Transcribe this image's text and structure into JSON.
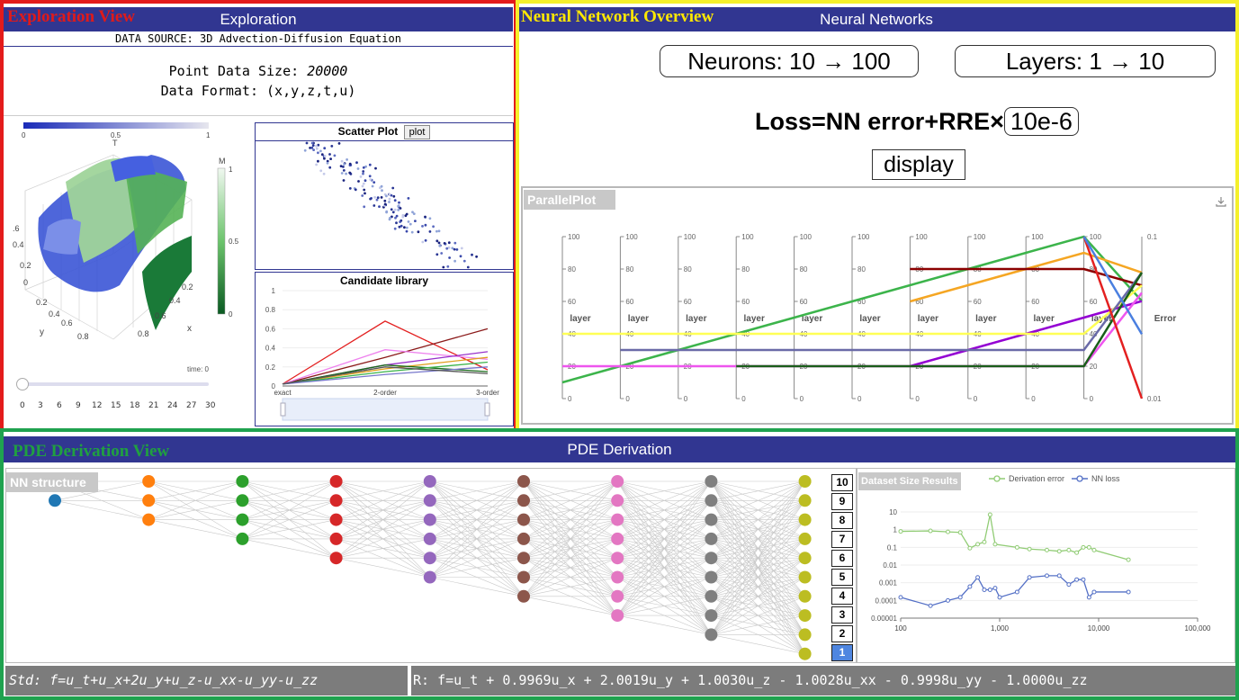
{
  "exploration": {
    "tag": "Exploration View",
    "title": "Exploration",
    "data_source": "DATA SOURCE: 3D Advection-Diffusion Equation",
    "point_size_label": "Point Data Size: ",
    "point_size_value": "20000",
    "data_format": "Data Format: (x,y,z,t,u)",
    "colorbar_t": {
      "label": "T",
      "ticks": [
        "0",
        "0.5",
        "1"
      ]
    },
    "colorbar_m": {
      "label": "M",
      "ticks": [
        "1",
        "0.5",
        "0"
      ]
    },
    "axis_labels": {
      "y": "y",
      "x": "x",
      "z_ticks": [
        ".6",
        "0.4",
        "0.2",
        "0",
        "0.2",
        "0.4",
        "0.6",
        "0.8"
      ],
      "x_ticks": [
        "0.2",
        "0.4",
        "0.6",
        "0.8",
        "x"
      ]
    },
    "time_label": "time: 0",
    "slider": {
      "value": 0,
      "ticks": [
        "0",
        "3",
        "6",
        "9",
        "12",
        "15",
        "18",
        "21",
        "24",
        "27",
        "30"
      ]
    },
    "scatter": {
      "title": "Scatter Plot",
      "button": "plot"
    },
    "candidate": {
      "title": "Candidate library",
      "chart_data": {
        "type": "line",
        "categories": [
          "exact",
          "2-order",
          "3-order"
        ],
        "ylim": [
          0,
          1
        ],
        "yticks": [
          "0",
          "0.2",
          "0.4",
          "0.6",
          "0.8",
          "1"
        ],
        "series": [
          {
            "values": [
              0.02,
              0.68,
              0.17
            ],
            "color": "#e32020"
          },
          {
            "values": [
              0.02,
              0.3,
              0.6
            ],
            "color": "#8b1a1a"
          },
          {
            "values": [
              0.02,
              0.38,
              0.28
            ],
            "color": "#ee82ee"
          },
          {
            "values": [
              0.02,
              0.22,
              0.36
            ],
            "color": "#9932cc"
          },
          {
            "values": [
              0.02,
              0.18,
              0.3
            ],
            "color": "#e0a020"
          },
          {
            "values": [
              0.02,
              0.22,
              0.15
            ],
            "color": "#1a6b1a"
          },
          {
            "values": [
              0.02,
              0.15,
              0.25
            ],
            "color": "#3cb44b"
          },
          {
            "values": [
              0.02,
              0.12,
              0.2
            ],
            "color": "#7777cc"
          },
          {
            "values": [
              0.02,
              0.2,
              0.13
            ],
            "color": "#555555"
          }
        ]
      }
    }
  },
  "neural": {
    "tag": "Neural Network Overview",
    "title": "Neural Networks",
    "neurons_label": "Neurons: 10 → 100",
    "layers_label": "Layers: 1 → 10",
    "loss_prefix": "Loss=NN error+RRE×",
    "loss_value": "10e-6",
    "display_button": "display",
    "parallel_title": "ParallelPlot",
    "chart_data": {
      "type": "parallel",
      "axis_label": "layer",
      "error_label": "Error",
      "layer_ticks": [
        "100",
        "80",
        "60",
        "40",
        "20",
        "0"
      ],
      "error_ticks": [
        "0.1",
        "0.01"
      ],
      "lines": [
        {
          "values": [
            10,
            20,
            30,
            40,
            50,
            60,
            70,
            80,
            90,
            100
          ],
          "error": 0.04,
          "color": "#3cb44b"
        },
        {
          "values": [
            null,
            null,
            null,
            null,
            null,
            null,
            60,
            70,
            80,
            90
          ],
          "error": 0.06,
          "color": "#f5a623"
        },
        {
          "values": [
            null,
            null,
            null,
            null,
            null,
            null,
            80,
            80,
            80,
            80
          ],
          "error": 0.05,
          "color": "#8b0000"
        },
        {
          "values": [
            null,
            null,
            null,
            null,
            null,
            null,
            20,
            30,
            40,
            50
          ],
          "error": 0.04,
          "color": "#9400d3"
        },
        {
          "values": [
            40,
            40,
            40,
            40,
            40,
            40,
            40,
            40,
            40,
            40
          ],
          "error": 0.05,
          "color": "#ffff55"
        },
        {
          "values": [
            null,
            30,
            30,
            30,
            30,
            30,
            30,
            30,
            30,
            30
          ],
          "error": 0.06,
          "color": "#6a6aa8"
        },
        {
          "values": [
            20,
            20,
            20,
            20,
            20,
            20,
            20,
            20,
            20,
            20
          ],
          "error": 0.045,
          "color": "#ee55ee"
        },
        {
          "values": [
            null,
            null,
            null,
            20,
            20,
            20,
            20,
            20,
            20,
            20
          ],
          "error": 0.06,
          "color": "#1a5e1a"
        },
        {
          "values": [
            null,
            null,
            null,
            null,
            null,
            null,
            null,
            null,
            null,
            100
          ],
          "error": 0.01,
          "color": "#e32020"
        },
        {
          "values": [
            null,
            null,
            null,
            null,
            null,
            null,
            null,
            null,
            null,
            100
          ],
          "error": 0.025,
          "color": "#4a7fe0"
        }
      ]
    }
  },
  "pde": {
    "tag": "PDE Derivation View",
    "title": "PDE Derivation",
    "nn_title": "NN structure",
    "nn_layers": [
      {
        "n": 2,
        "color": "#1f77b4"
      },
      {
        "n": 3,
        "color": "#ff7f0e"
      },
      {
        "n": 4,
        "color": "#2ca02c"
      },
      {
        "n": 5,
        "color": "#d62728"
      },
      {
        "n": 6,
        "color": "#9467bd"
      },
      {
        "n": 7,
        "color": "#8c564b"
      },
      {
        "n": 8,
        "color": "#e377c2"
      },
      {
        "n": 9,
        "color": "#7f7f7f"
      },
      {
        "n": 10,
        "color": "#bcbd22"
      }
    ],
    "layer_buttons": [
      "10",
      "9",
      "8",
      "7",
      "6",
      "5",
      "4",
      "3",
      "2",
      "1"
    ],
    "active_layer": "1",
    "dataset_title": "Dataset Size Results",
    "dataset_chart": {
      "type": "line",
      "x_scale": "log",
      "y_scale": "log",
      "xticks": [
        "100",
        "1,000",
        "10,000",
        "100,000"
      ],
      "yticks": [
        "10",
        "1",
        "0.1",
        "0.01",
        "0.001",
        "0.0001",
        "0.00001"
      ],
      "legend": [
        "Derivation error",
        "NN loss"
      ],
      "series": [
        {
          "name": "Derivation error",
          "color": "#91cc75",
          "x": [
            100,
            200,
            300,
            400,
            500,
            600,
            700,
            800,
            900,
            1500,
            2000,
            3000,
            4000,
            5000,
            6000,
            7000,
            8000,
            9000,
            20000
          ],
          "y": [
            0.8,
            0.85,
            0.75,
            0.7,
            0.09,
            0.15,
            0.2,
            7,
            0.15,
            0.1,
            0.08,
            0.07,
            0.06,
            0.07,
            0.05,
            0.1,
            0.1,
            0.07,
            0.02
          ]
        },
        {
          "name": "NN loss",
          "color": "#5470c6",
          "x": [
            100,
            200,
            300,
            400,
            500,
            600,
            700,
            800,
            900,
            1000,
            1500,
            2000,
            3000,
            4000,
            5000,
            6000,
            7000,
            8000,
            9000,
            20000
          ],
          "y": [
            0.00015,
            5e-05,
            0.0001,
            0.00015,
            0.0006,
            0.002,
            0.0004,
            0.0004,
            0.0005,
            0.00015,
            0.0003,
            0.002,
            0.0025,
            0.0025,
            0.0008,
            0.0015,
            0.0015,
            0.00015,
            0.0003,
            0.0003
          ]
        }
      ]
    },
    "std_eq": "Std: f=u_t+u_x+2u_y+u_z-u_xx-u_yy-u_zz",
    "result_eq": "R: f=u_t + 0.9969u_x + 2.0019u_y + 1.0030u_z - 1.0028u_xx - 0.9998u_yy - 1.0000u_zz"
  }
}
